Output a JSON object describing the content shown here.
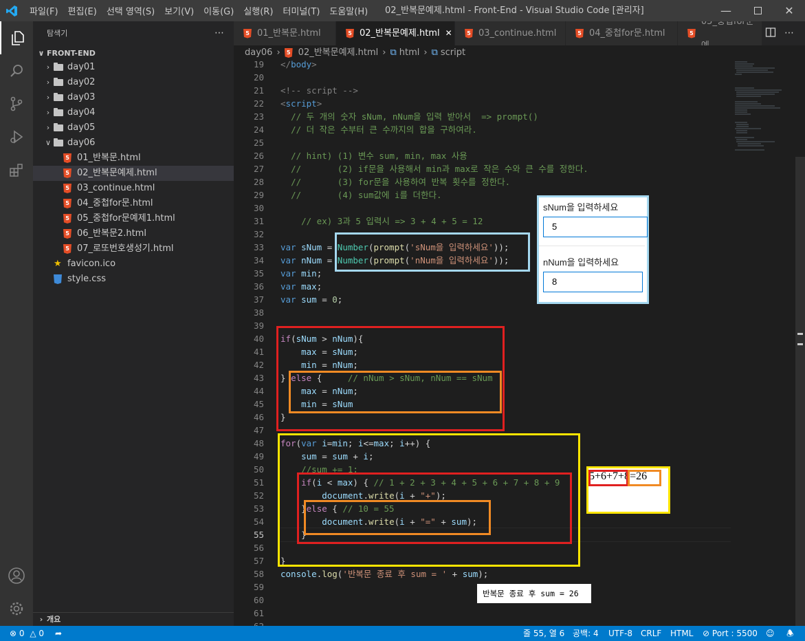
{
  "menu": [
    "파일(F)",
    "편집(E)",
    "선택 영역(S)",
    "보기(V)",
    "이동(G)",
    "실행(R)",
    "터미널(T)",
    "도움말(H)"
  ],
  "window_title": "02_반복문예제.html - Front-End - Visual Studio Code [관리자]",
  "sidebar": {
    "title": "탐색기",
    "root": "FRONT-END",
    "folders": [
      "day01",
      "day02",
      "day03",
      "day04",
      "day05"
    ],
    "open_folder": "day06",
    "files": [
      "01_반복문.html",
      "02_반복문예제.html",
      "03_continue.html",
      "04_중첩for문.html",
      "05_중첩for문예제1.html",
      "06_반복문2.html",
      "07_로또번호생성기.html"
    ],
    "root_files": [
      "favicon.ico",
      "style.css"
    ],
    "outline": "개요"
  },
  "tabs": [
    "01_반복문.html",
    "02_반복문예제.html",
    "03_continue.html",
    "04_중첩for문.html",
    "05_중첩for문예"
  ],
  "breadcrumb": [
    "day06",
    "02_반복문예제.html",
    "html",
    "script"
  ],
  "line_numbers": [
    "19",
    "20",
    "21",
    "22",
    "23",
    "24",
    "25",
    "26",
    "27",
    "28",
    "29",
    "30",
    "31",
    "32",
    "33",
    "34",
    "35",
    "36",
    "37",
    "38",
    "39",
    "40",
    "41",
    "42",
    "43",
    "44",
    "45",
    "46",
    "47",
    "48",
    "49",
    "50",
    "51",
    "52",
    "53",
    "54",
    "55",
    "56",
    "57",
    "58",
    "59",
    "60",
    "61",
    "62"
  ],
  "code_lines": [
    "</body>",
    "",
    "<!-- script -->",
    "<script>",
    "  // 두 개의 숫자 sNum, nNum을 입력 받아서  => prompt()",
    "  // 더 작은 수부터 큰 수까지의 합을 구하여라.",
    "",
    "  // hint) (1) 변수 sum, min, max 사용",
    "  //       (2) if문을 사용해서 min과 max로 작은 수와 큰 수를 정한다.",
    "  //       (3) for문을 사용하여 반복 횟수를 정한다.",
    "  //       (4) sum값에 i를 더한다.",
    "",
    "    // ex) 3과 5 입력시 => 3 + 4 + 5 = 12",
    "",
    "var sNum = Number(prompt('sNum을 입력하세요'));",
    "var nNum = Number(prompt('nNum을 입력하세요'));",
    "var min;",
    "var max;",
    "var sum = 0;",
    "",
    "",
    "if(sNum > nNum){",
    "    max = sNum;",
    "    min = nNum;",
    "} else {     // nNum > sNum, nNum == sNum",
    "    max = nNum;",
    "    min = sNum",
    "}",
    "",
    "for(var i=min; i<=max; i++) {",
    "    sum = sum + i;",
    "    //sum += 1;",
    "    if(i < max) { // 1 + 2 + 3 + 4 + 5 + 6 + 7 + 8 + 9",
    "        document.write(i + \"+\");",
    "    }else { // 10 = 55",
    "        document.write(i + \"=\" + sum);",
    "    }",
    "",
    "}",
    "console.log('반복문 종료 후 sum = ' + sum);",
    "",
    "",
    "",
    ""
  ],
  "prompt1": {
    "label": "sNum을 입력하세요",
    "value": "5"
  },
  "prompt2": {
    "label": "nNum을 입력하세요",
    "value": "8"
  },
  "output": "5+6+7+8=26",
  "console": "반복문 종료 후 sum = 26",
  "colors": {
    "red": "#e02020",
    "orange": "#f08a24",
    "yellow": "#ffe500",
    "lightblue": "#a5d8f0"
  },
  "status": {
    "errors": "0",
    "warnings": "0",
    "position": "줄 55, 열 6",
    "spaces": "공백: 4",
    "encoding": "UTF-8",
    "eol": "CRLF",
    "language": "HTML",
    "port": "Port : 5500"
  }
}
